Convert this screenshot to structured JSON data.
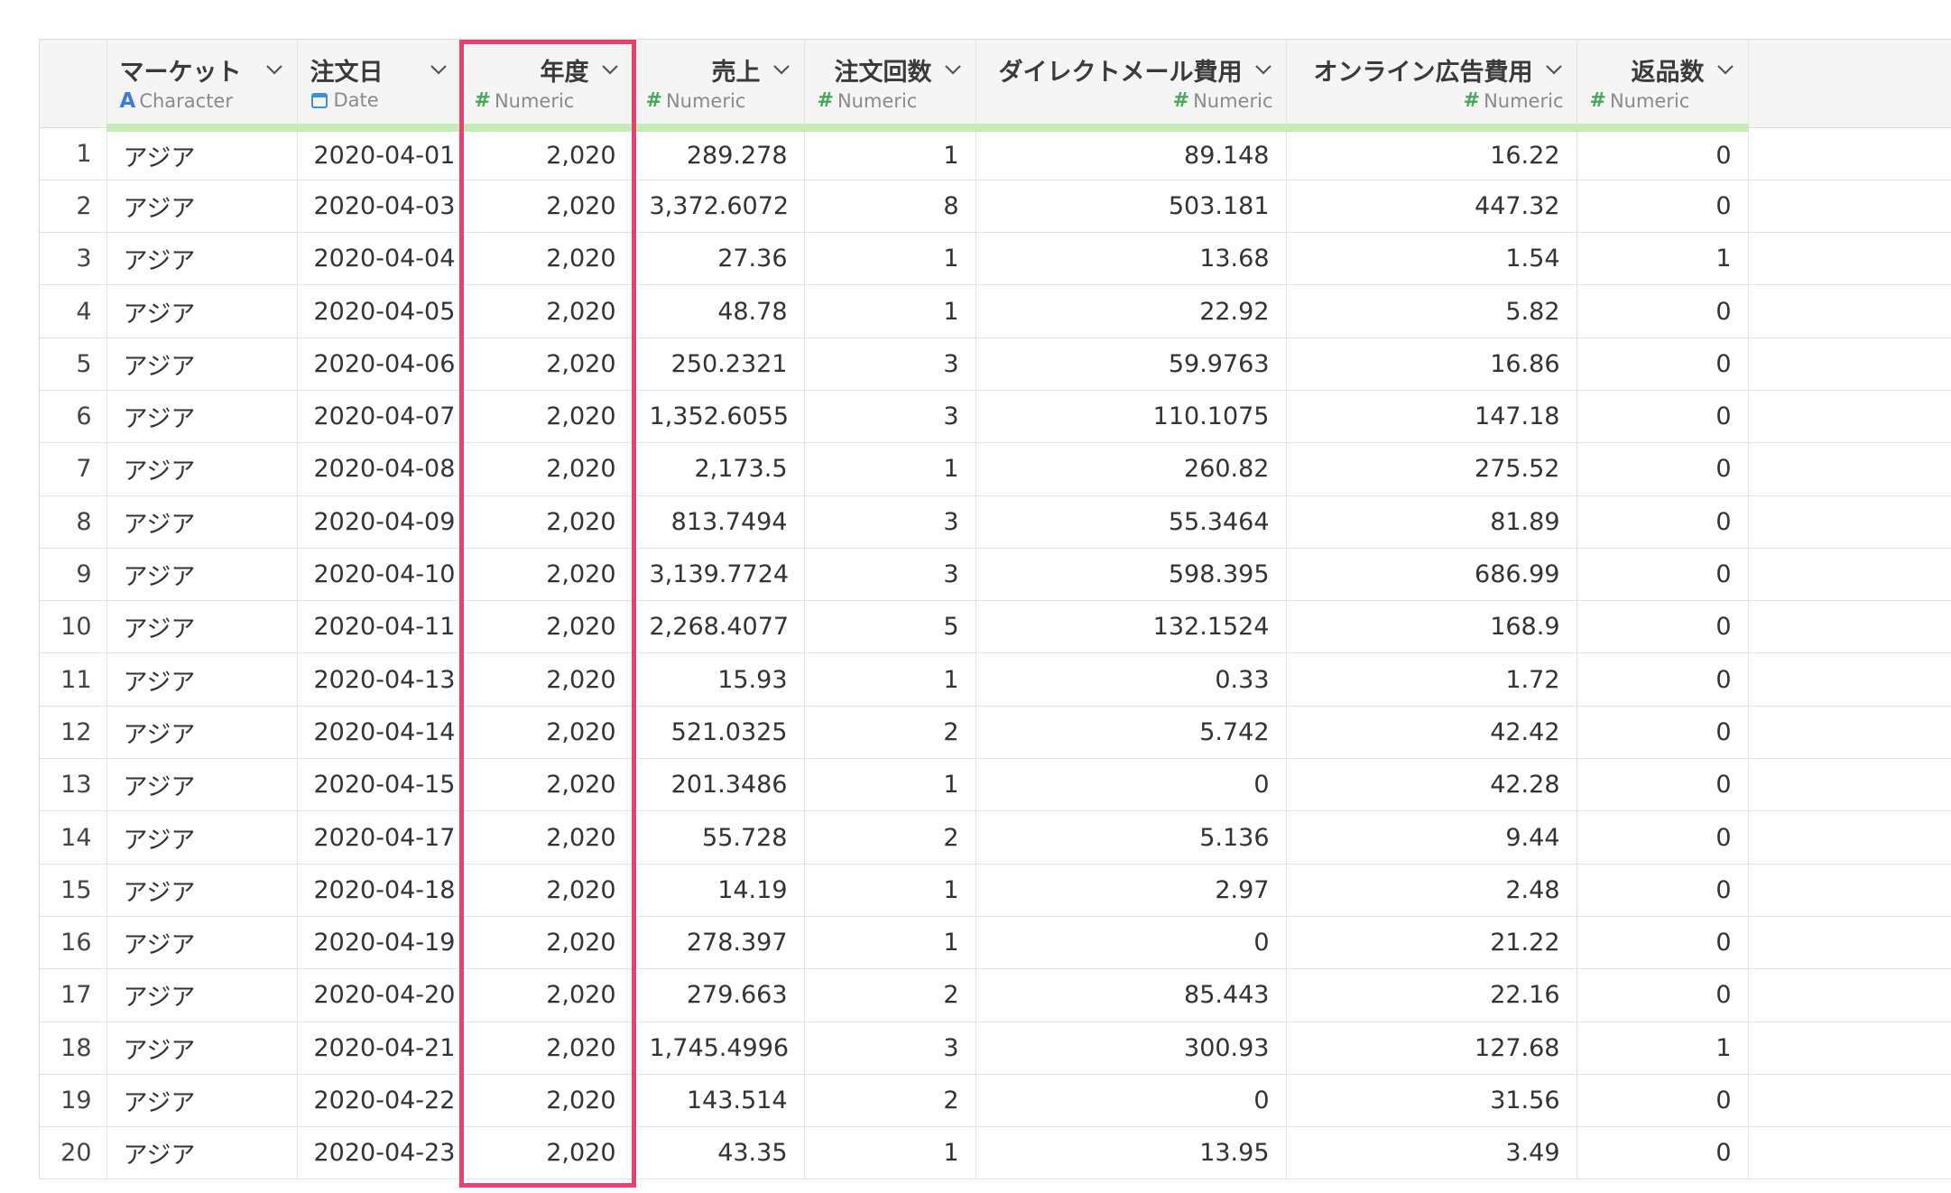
{
  "columns": [
    {
      "name": "マーケット",
      "type": "Character",
      "type_icon": "character-a-icon",
      "align": "left"
    },
    {
      "name": "注文日",
      "type": "Date",
      "type_icon": "calendar-icon",
      "align": "left"
    },
    {
      "name": "年度",
      "type": "Numeric",
      "type_icon": "hash-icon",
      "align": "right"
    },
    {
      "name": "売上",
      "type": "Numeric",
      "type_icon": "hash-icon",
      "align": "right"
    },
    {
      "name": "注文回数",
      "type": "Numeric",
      "type_icon": "hash-icon",
      "align": "right"
    },
    {
      "name": "ダイレクトメール費用",
      "type": "Numeric",
      "type_icon": "hash-icon",
      "align": "right"
    },
    {
      "name": "オンライン広告費用",
      "type": "Numeric",
      "type_icon": "hash-icon",
      "align": "right"
    },
    {
      "name": "返品数",
      "type": "Numeric",
      "type_icon": "hash-icon",
      "align": "right"
    }
  ],
  "colors": {
    "header_underline": "#c3ecb6",
    "highlight_border": "#e5426f",
    "numeric_icon": "#49a85a",
    "character_icon": "#3e7cd6"
  },
  "rows": [
    {
      "idx": "1",
      "cells": [
        "アジア",
        "2020-04-01",
        "2,020",
        "289.278",
        "1",
        "89.148",
        "16.22",
        "0"
      ]
    },
    {
      "idx": "2",
      "cells": [
        "アジア",
        "2020-04-03",
        "2,020",
        "3,372.6072",
        "8",
        "503.181",
        "447.32",
        "0"
      ]
    },
    {
      "idx": "3",
      "cells": [
        "アジア",
        "2020-04-04",
        "2,020",
        "27.36",
        "1",
        "13.68",
        "1.54",
        "1"
      ]
    },
    {
      "idx": "4",
      "cells": [
        "アジア",
        "2020-04-05",
        "2,020",
        "48.78",
        "1",
        "22.92",
        "5.82",
        "0"
      ]
    },
    {
      "idx": "5",
      "cells": [
        "アジア",
        "2020-04-06",
        "2,020",
        "250.2321",
        "3",
        "59.9763",
        "16.86",
        "0"
      ]
    },
    {
      "idx": "6",
      "cells": [
        "アジア",
        "2020-04-07",
        "2,020",
        "1,352.6055",
        "3",
        "110.1075",
        "147.18",
        "0"
      ]
    },
    {
      "idx": "7",
      "cells": [
        "アジア",
        "2020-04-08",
        "2,020",
        "2,173.5",
        "1",
        "260.82",
        "275.52",
        "0"
      ]
    },
    {
      "idx": "8",
      "cells": [
        "アジア",
        "2020-04-09",
        "2,020",
        "813.7494",
        "3",
        "55.3464",
        "81.89",
        "0"
      ]
    },
    {
      "idx": "9",
      "cells": [
        "アジア",
        "2020-04-10",
        "2,020",
        "3,139.7724",
        "3",
        "598.395",
        "686.99",
        "0"
      ]
    },
    {
      "idx": "10",
      "cells": [
        "アジア",
        "2020-04-11",
        "2,020",
        "2,268.4077",
        "5",
        "132.1524",
        "168.9",
        "0"
      ]
    },
    {
      "idx": "11",
      "cells": [
        "アジア",
        "2020-04-13",
        "2,020",
        "15.93",
        "1",
        "0.33",
        "1.72",
        "0"
      ]
    },
    {
      "idx": "12",
      "cells": [
        "アジア",
        "2020-04-14",
        "2,020",
        "521.0325",
        "2",
        "5.742",
        "42.42",
        "0"
      ]
    },
    {
      "idx": "13",
      "cells": [
        "アジア",
        "2020-04-15",
        "2,020",
        "201.3486",
        "1",
        "0",
        "42.28",
        "0"
      ]
    },
    {
      "idx": "14",
      "cells": [
        "アジア",
        "2020-04-17",
        "2,020",
        "55.728",
        "2",
        "5.136",
        "9.44",
        "0"
      ]
    },
    {
      "idx": "15",
      "cells": [
        "アジア",
        "2020-04-18",
        "2,020",
        "14.19",
        "1",
        "2.97",
        "2.48",
        "0"
      ]
    },
    {
      "idx": "16",
      "cells": [
        "アジア",
        "2020-04-19",
        "2,020",
        "278.397",
        "1",
        "0",
        "21.22",
        "0"
      ]
    },
    {
      "idx": "17",
      "cells": [
        "アジア",
        "2020-04-20",
        "2,020",
        "279.663",
        "2",
        "85.443",
        "22.16",
        "0"
      ]
    },
    {
      "idx": "18",
      "cells": [
        "アジア",
        "2020-04-21",
        "2,020",
        "1,745.4996",
        "3",
        "300.93",
        "127.68",
        "1"
      ]
    },
    {
      "idx": "19",
      "cells": [
        "アジア",
        "2020-04-22",
        "2,020",
        "143.514",
        "2",
        "0",
        "31.56",
        "0"
      ]
    },
    {
      "idx": "20",
      "cells": [
        "アジア",
        "2020-04-23",
        "2,020",
        "43.35",
        "1",
        "13.95",
        "3.49",
        "0"
      ]
    }
  ]
}
